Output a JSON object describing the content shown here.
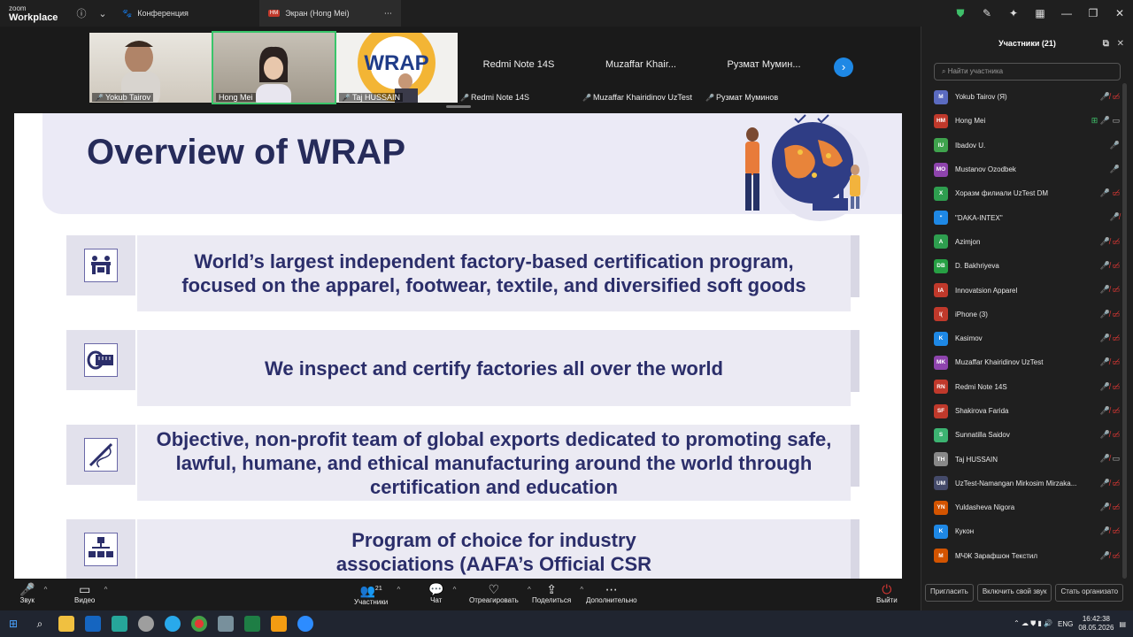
{
  "app": {
    "logo_top": "zoom",
    "logo_bottom": "Workplace"
  },
  "tabs": [
    {
      "label": "Конференция"
    },
    {
      "label": "Экран (Hong Mei)",
      "badge": "HM"
    }
  ],
  "strip": {
    "tiles": [
      {
        "name": "Yokub Tairov"
      },
      {
        "name": "Hong Mei"
      },
      {
        "name": "Taj HUSSAIN"
      }
    ],
    "name_tiles": [
      {
        "big": "Redmi Note 14S",
        "small": "Redmi Note 14S"
      },
      {
        "big": "Muzaffar  Khair...",
        "small": "Muzaffar Khairidinov UzTest"
      },
      {
        "big": "Рузмат Мумин...",
        "small": "Рузмат Муминов"
      }
    ]
  },
  "slide": {
    "title": "Overview of WRAP",
    "rows": [
      {
        "text": "World’s largest independent factory-based certification program, focused on the apparel, footwear, textile, and diversified soft goods",
        "icon": "workers-icon"
      },
      {
        "text": "We inspect and certify factories all over the world",
        "icon": "tape-measure-icon"
      },
      {
        "text": "Objective, non-profit team of global exports dedicated to promoting safe, lawful, humane, and ethical manufacturing around the world through certification and education",
        "icon": "needle-thread-icon"
      },
      {
        "text": "Program of choice for industry associations (AAFA’s Official CSR Partner)",
        "icon": "org-chart-icon"
      }
    ]
  },
  "participants": {
    "title": "Участники (21)",
    "search_placeholder": "Найти участника",
    "list": [
      {
        "initials": "M",
        "name": "Yokub Tairov (Я)",
        "color": "#5b6bc0",
        "status": "muted-video-off"
      },
      {
        "initials": "HM",
        "name": "Hong Mei",
        "color": "#c0392b",
        "status": "sharing"
      },
      {
        "initials": "IU",
        "name": "Ibadov U.",
        "color": "#3fa34d",
        "status": "mic"
      },
      {
        "initials": "MO",
        "name": "Mustanov Ozodbek",
        "color": "#8e44ad",
        "status": "mic"
      },
      {
        "initials": "X",
        "name": "Хоразм филиали UzTest DM",
        "color": "#2e9e4f",
        "status": "mic-video-off"
      },
      {
        "initials": "\"",
        "name": "\"DAKA-INTEX\"",
        "color": "#1e88e5",
        "status": "muted"
      },
      {
        "initials": "A",
        "name": "Azimjon",
        "color": "#2e9e4f",
        "status": "muted-video-off"
      },
      {
        "initials": "DB",
        "name": "D. Bakhriyeva",
        "color": "#27a044",
        "status": "muted-video-off"
      },
      {
        "initials": "IA",
        "name": "Innovatsion Apparel",
        "color": "#c0392b",
        "status": "muted-video-off"
      },
      {
        "initials": "I(",
        "name": "iPhone (3)",
        "color": "#c0392b",
        "status": "muted-video-off"
      },
      {
        "initials": "K",
        "name": "Kasimov",
        "color": "#1e88e5",
        "status": "muted-video-off"
      },
      {
        "initials": "MK",
        "name": "Muzaffar Khairidinov UzTest",
        "color": "#8e44ad",
        "status": "muted-video-off"
      },
      {
        "initials": "RN",
        "name": "Redmi Note 14S",
        "color": "#c0392b",
        "status": "muted-video-off"
      },
      {
        "initials": "SF",
        "name": "Shakirova Farida",
        "color": "#c0392b",
        "status": "muted-video-off"
      },
      {
        "initials": "S",
        "name": "Sunnatilla Saidov",
        "color": "#3cb371",
        "status": "muted-video-off"
      },
      {
        "initials": "TH",
        "name": "Taj HUSSAIN",
        "color": "#888888",
        "status": "muted-video"
      },
      {
        "initials": "UM",
        "name": "UzTest-Namangan Mirkosim Mirzaka...",
        "color": "#444a6a",
        "status": "muted-video-off"
      },
      {
        "initials": "YN",
        "name": "Yuldasheva Nigora",
        "color": "#d35400",
        "status": "muted-video-off"
      },
      {
        "initials": "K",
        "name": "Кукон",
        "color": "#1e88e5",
        "status": "muted-video-off"
      },
      {
        "initials": "M",
        "name": "МЧЖ Зарафшон Текстил",
        "color": "#d35400",
        "status": "muted-video-off"
      }
    ],
    "footer": [
      "Пригласить",
      "Включить свой звук",
      "Стать организато"
    ]
  },
  "toolbar": {
    "sound": "Звук",
    "video": "Видео",
    "participants": "Участники",
    "participants_count": "21",
    "chat": "Чат",
    "react": "Отреагировать",
    "share": "Поделиться",
    "more": "Дополнительно",
    "leave": "Выйти"
  },
  "taskbar": {
    "lang": "ENG",
    "time": "16:42:38",
    "date": "08.05.2026"
  }
}
